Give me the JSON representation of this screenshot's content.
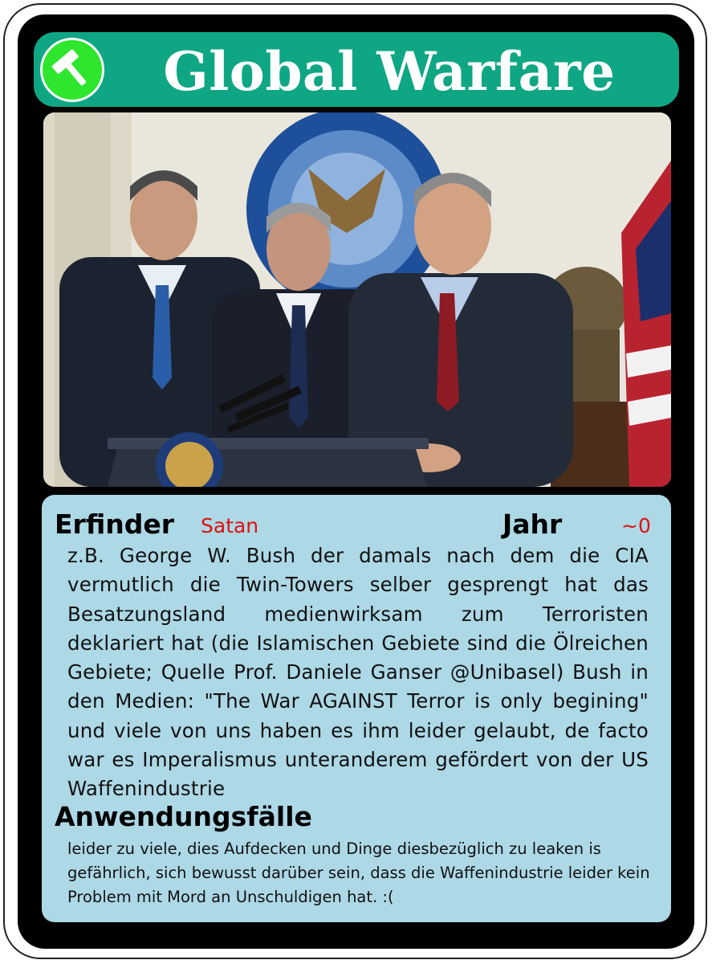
{
  "card": {
    "title": "Global Warfare",
    "icon": "hammer-icon",
    "colors": {
      "title_bar": "#0fa684",
      "icon_circle": "#2ee62e",
      "panel": "#add8e6",
      "accent_red": "#e01010"
    }
  },
  "info": {
    "inventor_label": "Erfinder",
    "inventor_value": "Satan",
    "year_label": "Jahr",
    "year_value": "~0",
    "description": "z.B. George W. Bush der damals nach dem die CIA vermutlich die Twin-Towers selber gesprengt hat das Besatzungsland medienwirksam zum Terroristen deklariert hat (die Islamischen Gebiete sind die Ölreichen Gebiete; Quelle Prof. Daniele Ganser @Unibasel) Bush in den Medien: \"The War AGAINST Terror is only begining\" und viele von uns haben es ihm leider gelaubt, de facto war es Imperalismus unteranderem gefördert von der US Waffenindustrie",
    "uses_label": "Anwendungsfälle",
    "uses_text": "leider zu viele, dies Aufdecken und Dinge diesbezüglich zu leaken is gefährlich, sich bewusst darüber sein, dass die Waffenindustrie leider kein Problem mit Mord an Unschuldigen hat. :("
  }
}
